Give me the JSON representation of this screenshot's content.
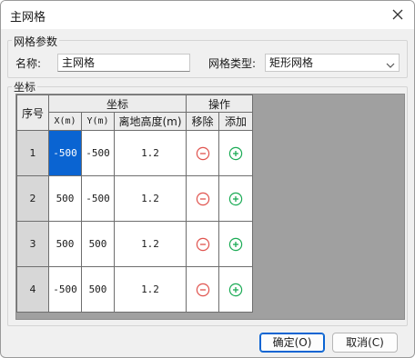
{
  "window": {
    "title": "主网格"
  },
  "params": {
    "group_label": "网格参数",
    "name_label": "名称:",
    "name_value": "主网格",
    "type_label": "网格类型:",
    "type_value": "矩形网格"
  },
  "coords": {
    "group_label": "坐标"
  },
  "table": {
    "h_index": "序号",
    "h_coord": "坐标",
    "h_ops": "操作",
    "h_x": "X(m)",
    "h_y": "Y(m)",
    "h_height": "离地高度(m)",
    "h_remove": "移除",
    "h_add": "添加",
    "rows": [
      {
        "index": "1",
        "x": "-500",
        "y": "-500",
        "height": "1.2"
      },
      {
        "index": "2",
        "x": "500",
        "y": "-500",
        "height": "1.2"
      },
      {
        "index": "3",
        "x": "500",
        "y": "500",
        "height": "1.2"
      },
      {
        "index": "4",
        "x": "-500",
        "y": "500",
        "height": "1.2"
      }
    ]
  },
  "buttons": {
    "ok": "确定(O)",
    "cancel": "取消(C)"
  },
  "colors": {
    "remove_icon": "#e0544f",
    "add_icon": "#1bab55",
    "selection": "#0a64d2"
  },
  "icons": {
    "close": "close-icon",
    "remove": "minus-circle-icon",
    "add": "plus-circle-icon",
    "dropdown": "chevron-down-icon"
  }
}
